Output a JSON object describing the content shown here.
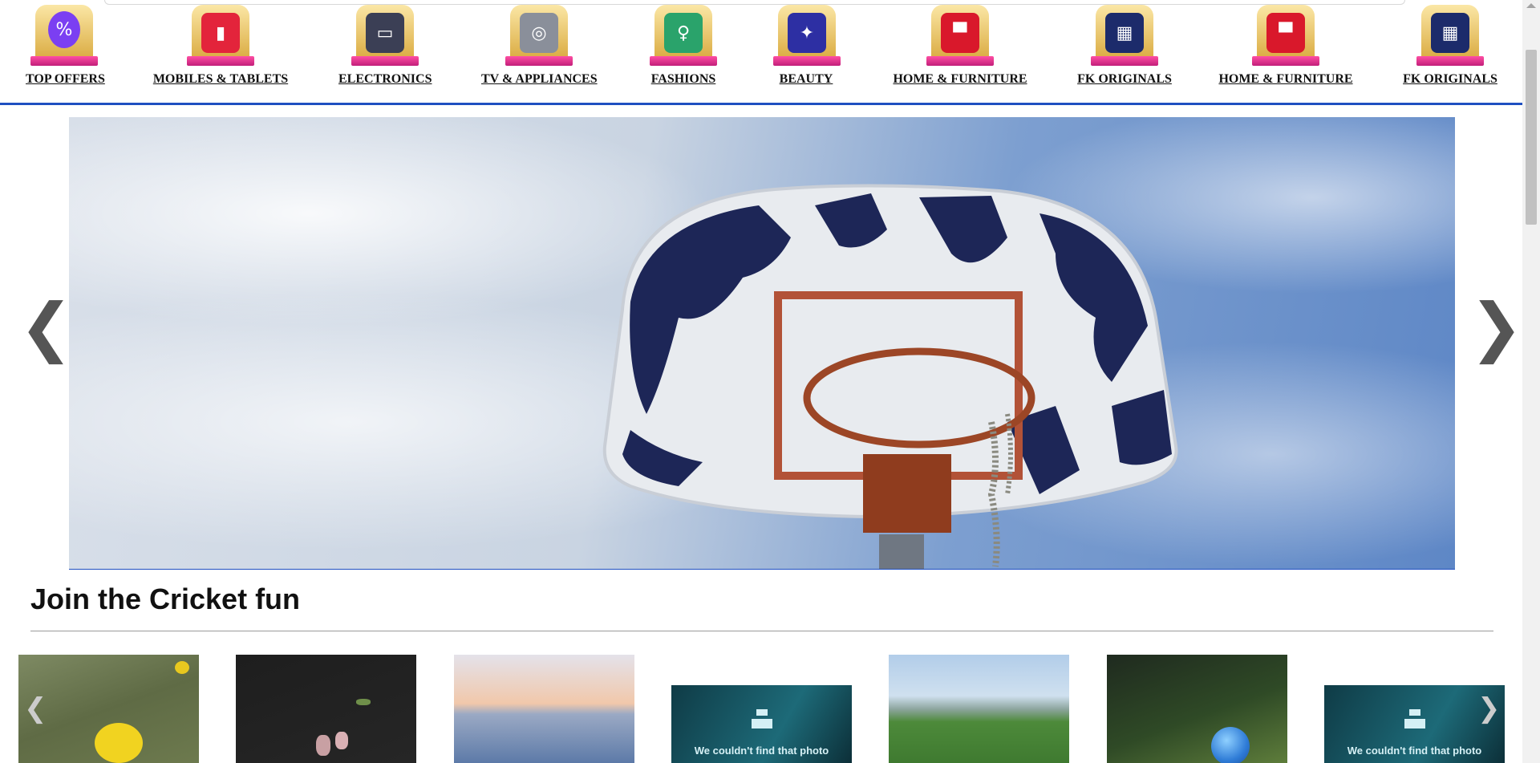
{
  "nav": {
    "items": [
      {
        "label": "TOP OFFERS",
        "icon": "discount-badge-icon",
        "color": "#7b3ff2",
        "glyph": "%"
      },
      {
        "label": "MOBILES & TABLETS",
        "icon": "smartphone-icon",
        "color": "#e3243b",
        "glyph": "▮"
      },
      {
        "label": "ELECTRONICS",
        "icon": "laptop-icon",
        "color": "#3b3f55",
        "glyph": "▭"
      },
      {
        "label": "TV & APPLIANCES",
        "icon": "washing-machine-icon",
        "color": "#8a8f9a",
        "glyph": "◎"
      },
      {
        "label": "FASHIONS",
        "icon": "fashion-couple-icon",
        "color": "#2aa36b",
        "glyph": "♀"
      },
      {
        "label": "BEAUTY",
        "icon": "beauty-products-icon",
        "color": "#2d2fa3",
        "glyph": "✦"
      },
      {
        "label": "HOME & FURNITURE",
        "icon": "armchair-icon",
        "color": "#d9182b",
        "glyph": "▀"
      },
      {
        "label": "FK ORIGINALS",
        "icon": "fk-originals-icon",
        "color": "#1c2b6b",
        "glyph": "▦"
      },
      {
        "label": "HOME & FURNITURE",
        "icon": "armchair-icon",
        "color": "#d9182b",
        "glyph": "▀"
      },
      {
        "label": "FK ORIGINALS",
        "icon": "fk-originals-icon",
        "color": "#1c2b6b",
        "glyph": "▦"
      }
    ]
  },
  "hero": {
    "prev": "❮",
    "next": "❯",
    "image": "basketball-hoop-photo"
  },
  "section": {
    "title": "Join the Cricket fun"
  },
  "thumbs": {
    "prev": "❮",
    "next": "❯",
    "items": [
      {
        "image": "yellow-flowers-photo",
        "bg": "linear-gradient(160deg,#7e8a63,#5f6b45 50%,#c9b43a 80%,#6d7a4e)"
      },
      {
        "image": "pink-flowers-dark-photo",
        "bg": "linear-gradient(160deg,#1e1e1e,#2a2a2a 60%,#5b4a47)"
      },
      {
        "image": "sunset-sea-photo",
        "bg": "linear-gradient(180deg,#e9e5ea,#f3c9a8 40%,#8aa0bf 60%,#5c7aa8)"
      },
      {
        "image": "not-found-placeholder",
        "bg": "linear-gradient(120deg,#0f3b46,#1d6a78 60%,#0c2f38)",
        "message": "We couldn't find that photo"
      },
      {
        "image": "cricket-field-photo",
        "bg": "linear-gradient(180deg,#a9c8ea,#c8dcef 35%,#8fa99a 48%,#4d8a3a 60%,#3f7a30)"
      },
      {
        "image": "globe-on-grass-photo",
        "bg": "linear-gradient(160deg,#1f2a1f,#3a5a2e 55%,#5e7d3b)"
      },
      {
        "image": "not-found-placeholder",
        "bg": "linear-gradient(120deg,#0f3b46,#1d6a78 60%,#0c2f38)",
        "message": "We couldn't find that photo"
      }
    ]
  }
}
